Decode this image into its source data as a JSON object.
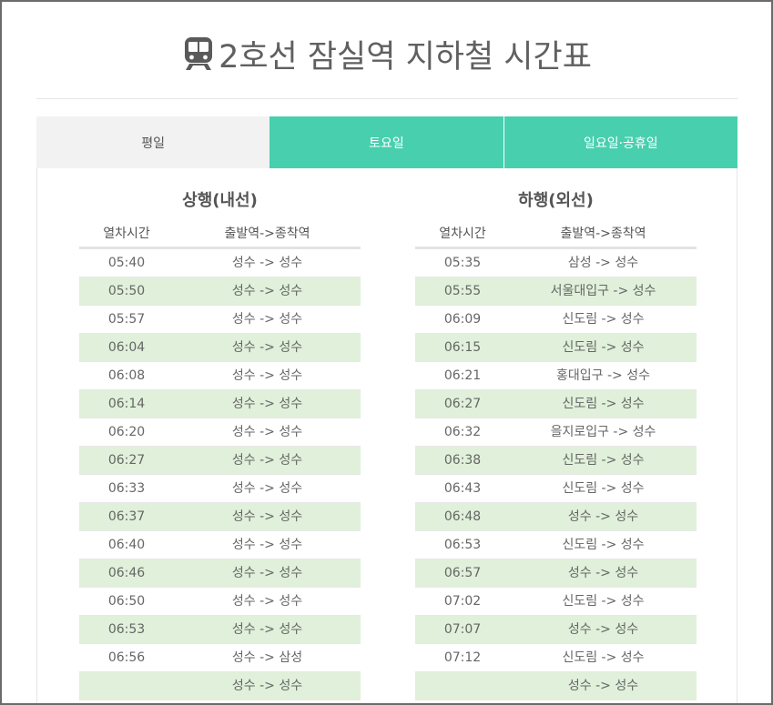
{
  "title": "2호선 잠실역 지하철 시간표",
  "tabs": [
    {
      "label": "평일",
      "active": true
    },
    {
      "label": "토요일",
      "active": false
    },
    {
      "label": "일요일·공휴일",
      "active": false
    }
  ],
  "up": {
    "heading": "상행(내선)",
    "col_time": "열차시간",
    "col_route": "출발역->종착역",
    "rows": [
      {
        "time": "05:40",
        "route": "성수 -> 성수"
      },
      {
        "time": "05:50",
        "route": "성수 -> 성수"
      },
      {
        "time": "05:57",
        "route": "성수 -> 성수"
      },
      {
        "time": "06:04",
        "route": "성수 -> 성수"
      },
      {
        "time": "06:08",
        "route": "성수 -> 성수"
      },
      {
        "time": "06:14",
        "route": "성수 -> 성수"
      },
      {
        "time": "06:20",
        "route": "성수 -> 성수"
      },
      {
        "time": "06:27",
        "route": "성수 -> 성수"
      },
      {
        "time": "06:33",
        "route": "성수 -> 성수"
      },
      {
        "time": "06:37",
        "route": "성수 -> 성수"
      },
      {
        "time": "06:40",
        "route": "성수 -> 성수"
      },
      {
        "time": "06:46",
        "route": "성수 -> 성수"
      },
      {
        "time": "06:50",
        "route": "성수 -> 성수"
      },
      {
        "time": "06:53",
        "route": "성수 -> 성수"
      },
      {
        "time": "06:56",
        "route": "성수 -> 삼성"
      },
      {
        "time": "",
        "route": "성수 -> 성수"
      }
    ]
  },
  "down": {
    "heading": "하행(외선)",
    "col_time": "열차시간",
    "col_route": "출발역->종착역",
    "rows": [
      {
        "time": "05:35",
        "route": "삼성 -> 성수"
      },
      {
        "time": "05:55",
        "route": "서울대입구 -> 성수"
      },
      {
        "time": "06:09",
        "route": "신도림 -> 성수"
      },
      {
        "time": "06:15",
        "route": "신도림 -> 성수"
      },
      {
        "time": "06:21",
        "route": "홍대입구 -> 성수"
      },
      {
        "time": "06:27",
        "route": "신도림 -> 성수"
      },
      {
        "time": "06:32",
        "route": "을지로입구 -> 성수"
      },
      {
        "time": "06:38",
        "route": "신도림 -> 성수"
      },
      {
        "time": "06:43",
        "route": "신도림 -> 성수"
      },
      {
        "time": "06:48",
        "route": "성수 -> 성수"
      },
      {
        "time": "06:53",
        "route": "신도림 -> 성수"
      },
      {
        "time": "06:57",
        "route": "성수 -> 성수"
      },
      {
        "time": "07:02",
        "route": "신도림 -> 성수"
      },
      {
        "time": "07:07",
        "route": "성수 -> 성수"
      },
      {
        "time": "07:12",
        "route": "신도림 -> 성수"
      },
      {
        "time": "",
        "route": "성수 -> 성수"
      }
    ]
  },
  "colors": {
    "accent": "#48cfae",
    "row_alt": "#e0f0da",
    "tab_active_bg": "#f2f2f2"
  },
  "icons": {
    "title_icon": "train-icon"
  }
}
